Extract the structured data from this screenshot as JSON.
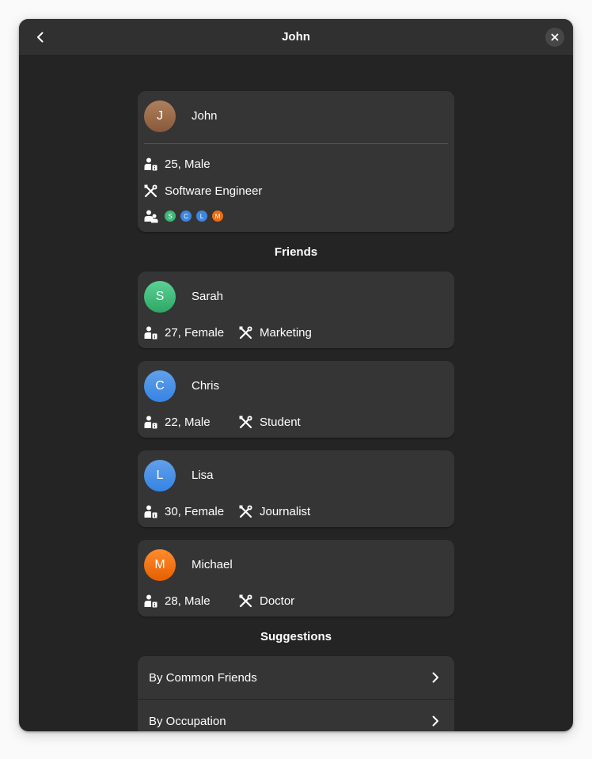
{
  "window": {
    "title": "John"
  },
  "profile": {
    "initial": "J",
    "name": "John",
    "age_gender": "25, Male",
    "occupation": "Software Engineer",
    "friend_initials": [
      "S",
      "C",
      "L",
      "M"
    ]
  },
  "friends_heading": "Friends",
  "friends": [
    {
      "initial": "S",
      "name": "Sarah",
      "age_gender": "27, Female",
      "occupation": "Marketing"
    },
    {
      "initial": "C",
      "name": "Chris",
      "age_gender": "22, Male",
      "occupation": "Student"
    },
    {
      "initial": "L",
      "name": "Lisa",
      "age_gender": "30, Female",
      "occupation": "Journalist"
    },
    {
      "initial": "M",
      "name": "Michael",
      "age_gender": "28, Male",
      "occupation": "Doctor"
    }
  ],
  "suggestions_heading": "Suggestions",
  "suggestions": [
    {
      "label": "By Common Friends"
    },
    {
      "label": "By Occupation"
    }
  ],
  "colors": {
    "window_bg": "#242424",
    "card_bg": "#353535",
    "header_bg": "#303030",
    "avatar_john": "#9a6a4a",
    "avatar_sarah": "#3db877",
    "avatar_chris": "#3d86e0",
    "avatar_lisa": "#3d86e0",
    "avatar_michael": "#ef6d12"
  },
  "icons": {
    "back": "go-previous-icon",
    "close": "window-close-icon",
    "person_info": "person-info-icon",
    "occupation": "tools-icon",
    "friends": "people-icon",
    "chevron": "go-next-icon"
  }
}
